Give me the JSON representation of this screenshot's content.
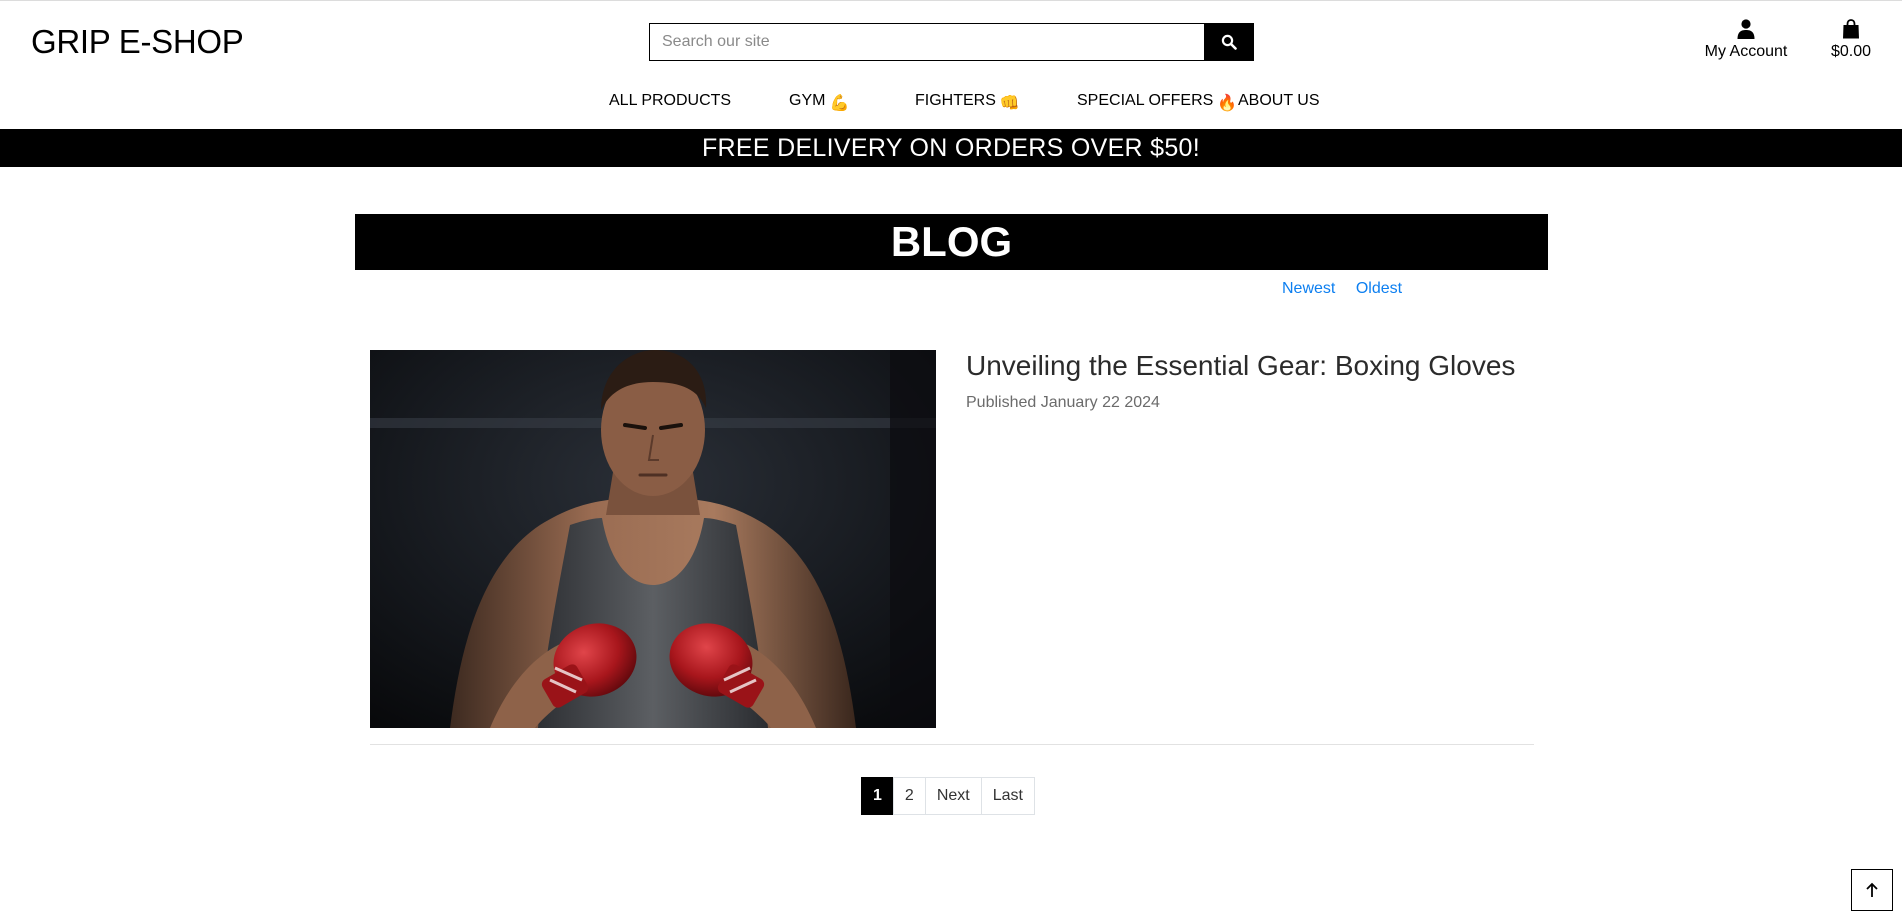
{
  "header": {
    "brand": "GRIP E-SHOP",
    "search": {
      "placeholder": "Search our site",
      "icon": "search-icon"
    },
    "account": {
      "label": "My Account",
      "icon": "user-icon"
    },
    "bag": {
      "label": "$0.00",
      "icon": "shopping-bag-icon"
    }
  },
  "nav": {
    "items": [
      {
        "label": "ALL PRODUCTS",
        "emoji": ""
      },
      {
        "label": "GYM",
        "emoji": "💪"
      },
      {
        "label": "FIGHTERS",
        "emoji": "👊"
      },
      {
        "label": "SPECIAL OFFERS",
        "emoji": "🔥"
      },
      {
        "label": "ABOUT US",
        "emoji": ""
      }
    ]
  },
  "banner": {
    "text": "FREE DELIVERY ON ORDERS OVER $50!"
  },
  "blog": {
    "title": "BLOG",
    "sort": {
      "newest": "Newest",
      "oldest": "Oldest"
    },
    "posts": [
      {
        "title": "Unveiling the Essential Gear: Boxing Gloves",
        "date": "Published January 22 2024"
      }
    ]
  },
  "pagination": {
    "pages": [
      "1",
      "2"
    ],
    "current": "1",
    "next": "Next",
    "last": "Last"
  },
  "colors": {
    "brand": "#000000",
    "link": "#0d7ff0",
    "glove": "#b3161c"
  }
}
